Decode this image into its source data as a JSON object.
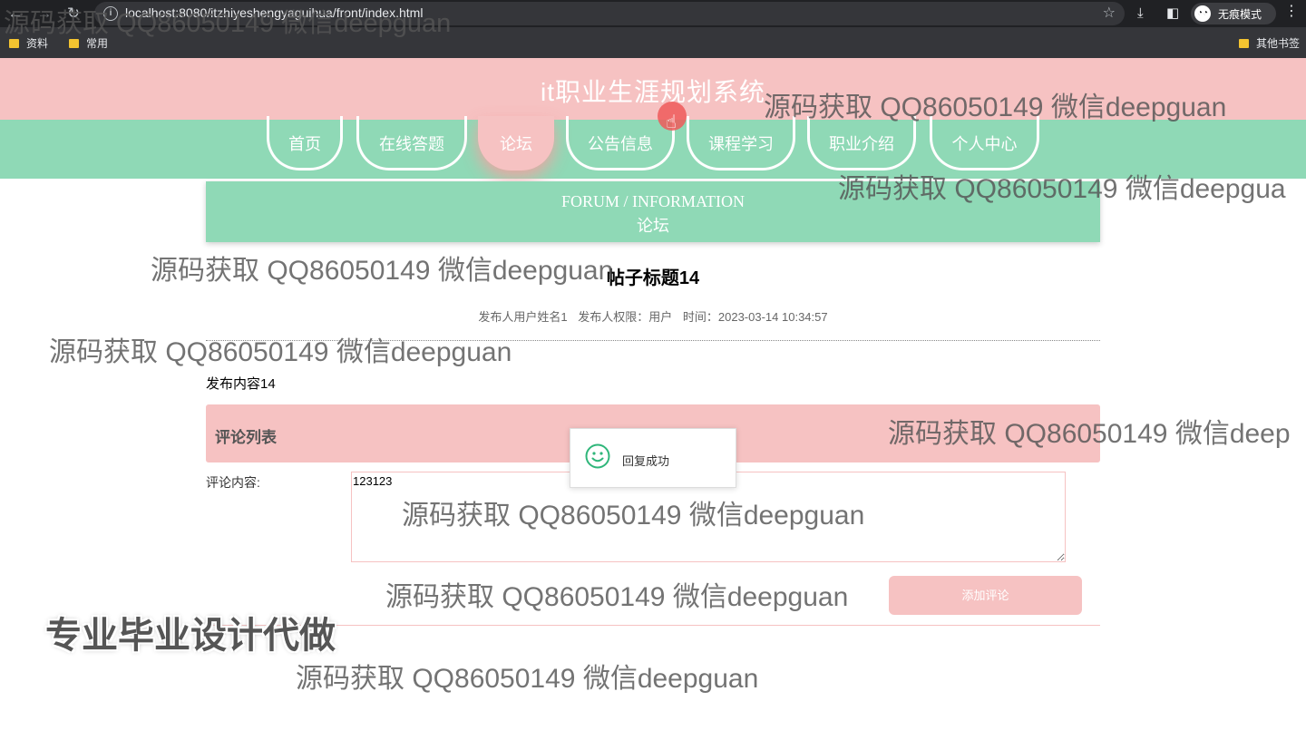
{
  "browser": {
    "url": "localhost:8080/itzhiyeshengyaguihua/front/index.html",
    "incognito_label": "无痕模式",
    "bookmarks": [
      "资料",
      "常用"
    ],
    "other_bookmarks": "其他书签"
  },
  "site": {
    "title": "it职业生涯规划系统",
    "nav": [
      {
        "label": "首页"
      },
      {
        "label": "在线答题"
      },
      {
        "label": "论坛",
        "active": true
      },
      {
        "label": "公告信息"
      },
      {
        "label": "课程学习"
      },
      {
        "label": "职业介绍"
      },
      {
        "label": "个人中心"
      }
    ]
  },
  "banner": {
    "en": "FORUM / INFORMATION",
    "cn": "论坛"
  },
  "post": {
    "title": "帖子标题14",
    "author": "发布人用户姓名1",
    "role": "发布人权限：用户",
    "time": "时间：2023-03-14 10:34:57",
    "content": "发布内容14"
  },
  "comments": {
    "header": "评论列表",
    "label": "评论内容:",
    "input_value": "123123",
    "submit_label": "添加评论"
  },
  "toast": {
    "message": "回复成功"
  },
  "overlay": {
    "watermark": "源码获取 QQ86050149 微信deepguan",
    "watermark_cut_1": "源码获取 QQ86050149 微信deepgua",
    "watermark_cut_2": "源码获取 QQ86050149 微信deep",
    "promo": "专业毕业设计代做"
  }
}
